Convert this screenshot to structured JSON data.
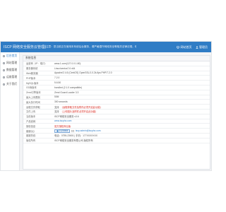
{
  "header": {
    "brand": "ISCP 网络安全服务云管理后台",
    "notice": "注意：您当前正在使用本系统后台服务，请严格遵守网络安全等相关法律法规，切勿非法操作",
    "menu_label": "网站首页",
    "user_label": "管理员"
  },
  "sidebar": {
    "items": [
      {
        "label": "后台首页",
        "icon": "home-icon"
      },
      {
        "label": "网站管理",
        "icon": "grid-icon"
      },
      {
        "label": "数据管理",
        "icon": "database-icon"
      },
      {
        "label": "运维管理",
        "icon": "tool-icon"
      },
      {
        "label": "关于我们",
        "icon": "info-icon"
      }
    ]
  },
  "panel": {
    "title": "系统信息",
    "rows": [
      {
        "label": "运营商（IP：端口）",
        "value": "www.1.com(127.0.0.1:80)"
      },
      {
        "label": "服务器系统",
        "value": "Linux/centos7.6 x64"
      },
      {
        "label": "Web服务器",
        "value": "Apache/2.4.6 (CentOS) OpenSSL/1.0.2k-fips PHP/7.2.0"
      },
      {
        "label": "PHP版本",
        "value": "7.2.0"
      },
      {
        "label": "MySQL版本",
        "value": "5.6.50"
      },
      {
        "label": "GD库版本",
        "value": "bundled (2.1.0 compatible)"
      },
      {
        "label": "Zend引擎版本",
        "value": "Zend Guard Loader 3.3"
      },
      {
        "label": "最大上传限制",
        "value": "50M"
      },
      {
        "label": "最大执行时间",
        "value": "300 seconds"
      },
      {
        "label": "远程文件获取",
        "value": "支持",
        "extra": "（远程获取文件及附件必须开启此功能）"
      },
      {
        "label": "文件上传",
        "value": "支持",
        "extra": "（上传图片及附件必须开启此功能）"
      },
      {
        "label": "当前版本",
        "value": "ISCP网络安全服务 v3.6"
      },
      {
        "label": "产品官网",
        "value": "www.iscphz.com"
      },
      {
        "label": "授权信息",
        "value": "官方授权商业版"
      },
      {
        "label": "客服QQ",
        "qq": "2125564",
        "email": "iscp.admin@iscphz.com"
      },
      {
        "label": "客服热线",
        "value": "电话：0755-23601  |  手机：177XXXXXXX"
      },
      {
        "label": "版权所有",
        "value": "ISCP网络安全服务有限公司 版权所有"
      }
    ]
  }
}
